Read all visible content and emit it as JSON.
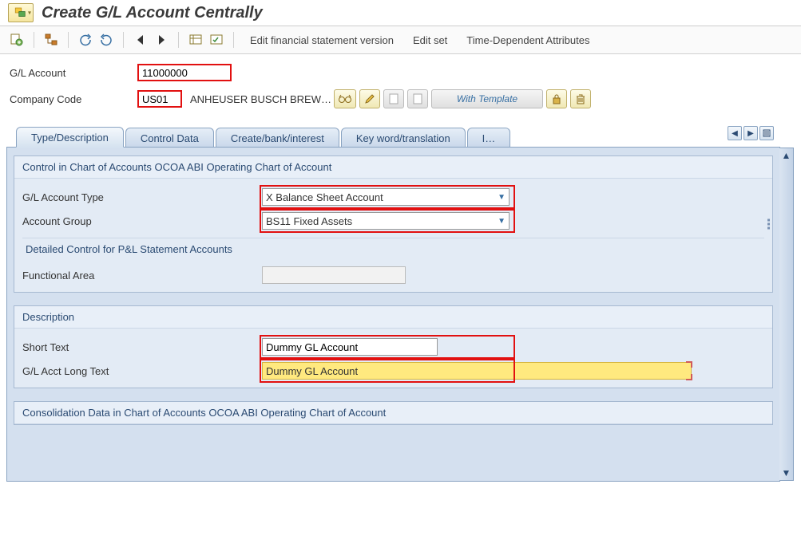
{
  "header": {
    "title": "Create G/L Account Centrally"
  },
  "toolbar": {
    "edit_fin": "Edit financial statement version",
    "edit_set": "Edit set",
    "time_dep": "Time-Dependent Attributes"
  },
  "fields": {
    "gl_account_label": "G/L Account",
    "gl_account_value": "11000000",
    "company_code_label": "Company Code",
    "company_code_value": "US01",
    "company_code_name": "ANHEUSER BUSCH BREWI…",
    "with_template": "With Template"
  },
  "tabs": {
    "t1": "Type/Description",
    "t2": "Control Data",
    "t3": "Create/bank/interest",
    "t4": "Key word/translation",
    "t5": "I…"
  },
  "group1": {
    "title": "Control in Chart of Accounts OCOA ABI Operating Chart of Account",
    "gl_type_label": "G/L Account Type",
    "gl_type_value": "X Balance Sheet Account",
    "acct_group_label": "Account Group",
    "acct_group_value": "BS11 Fixed Assets",
    "sub_title": "Detailed Control for P&L Statement Accounts",
    "func_area_label": "Functional Area",
    "func_area_value": ""
  },
  "group2": {
    "title": "Description",
    "short_text_label": "Short Text",
    "short_text_value": "Dummy GL Account",
    "long_text_label": "G/L Acct Long Text",
    "long_text_value": "Dummy GL Account"
  },
  "group3": {
    "title": "Consolidation Data in Chart of Accounts OCOA ABI Operating Chart of Account"
  }
}
